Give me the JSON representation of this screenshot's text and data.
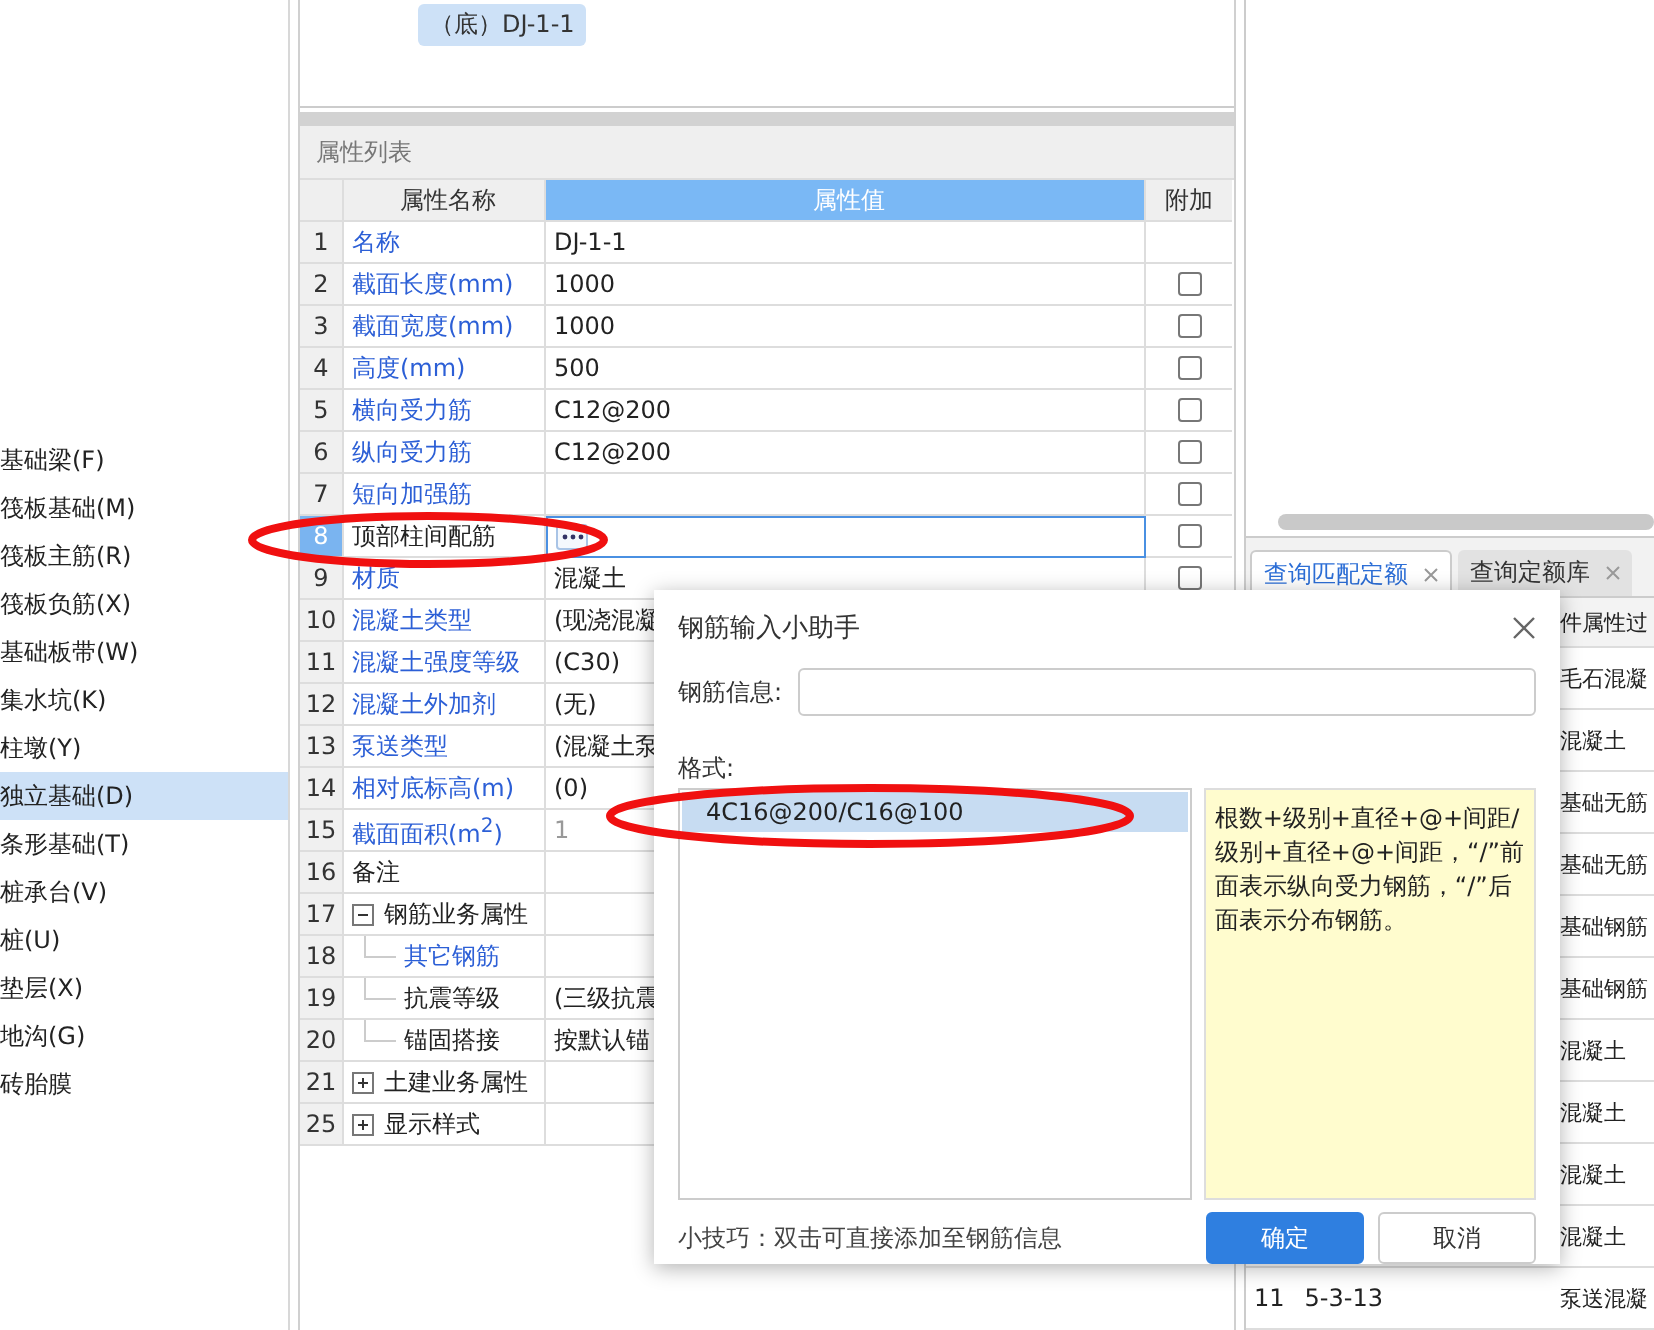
{
  "sidebar": {
    "items": [
      {
        "label": "基础梁(F)",
        "selected": false
      },
      {
        "label": "筏板基础(M)",
        "selected": false
      },
      {
        "label": "筏板主筋(R)",
        "selected": false
      },
      {
        "label": "筏板负筋(X)",
        "selected": false
      },
      {
        "label": "基础板带(W)",
        "selected": false
      },
      {
        "label": "集水坑(K)",
        "selected": false
      },
      {
        "label": "柱墩(Y)",
        "selected": false
      },
      {
        "label": "独立基础(D)",
        "selected": true
      },
      {
        "label": "条形基础(T)",
        "selected": false
      },
      {
        "label": "桩承台(V)",
        "selected": false
      },
      {
        "label": "桩(U)",
        "selected": false
      },
      {
        "label": "垫层(X)",
        "selected": false
      },
      {
        "label": "地沟(G)",
        "selected": false
      },
      {
        "label": "砖胎膜",
        "selected": false
      }
    ]
  },
  "preview": {
    "tag": "（底）DJ-1-1"
  },
  "properties": {
    "title": "属性列表",
    "columns": [
      {
        "label": "属性名称",
        "selected": false
      },
      {
        "label": "属性值",
        "selected": true
      },
      {
        "label": "附加",
        "selected": false
      }
    ],
    "rows": [
      {
        "number": "1",
        "name": "名称",
        "value": "DJ-1-1",
        "kind": "public",
        "selected": false
      },
      {
        "number": "2",
        "name": "截面长度(mm)",
        "value": "1000",
        "kind": "public",
        "selected": false,
        "checked": false
      },
      {
        "number": "3",
        "name": "截面宽度(mm)",
        "value": "1000",
        "kind": "public",
        "selected": false,
        "checked": false
      },
      {
        "number": "4",
        "name": "高度(mm)",
        "value": "500",
        "kind": "public",
        "selected": false,
        "checked": false
      },
      {
        "number": "5",
        "name": "横向受力筋",
        "value": "C12@200",
        "kind": "public",
        "selected": false,
        "checked": false
      },
      {
        "number": "6",
        "name": "纵向受力筋",
        "value": "C12@200",
        "kind": "public",
        "selected": false,
        "checked": false
      },
      {
        "number": "7",
        "name": "短向加强筋",
        "kind": "public",
        "selected": false,
        "checked": false
      },
      {
        "number": "8",
        "name": "顶部柱间配筋",
        "kind": "private",
        "selected": true,
        "checked": false
      },
      {
        "number": "9",
        "name": "材质",
        "value": "混凝土",
        "kind": "public",
        "selected": false,
        "checked": false
      },
      {
        "number": "10",
        "name": "混凝土类型",
        "value": "(现浇混凝",
        "kind": "public",
        "selected": false
      },
      {
        "number": "11",
        "name": "混凝土强度等级",
        "value": "(C30)",
        "kind": "public",
        "selected": false
      },
      {
        "number": "12",
        "name": "混凝土外加剂",
        "value": "(无)",
        "kind": "public",
        "selected": false
      },
      {
        "number": "13",
        "name": "泵送类型",
        "value": "(混凝土泵",
        "kind": "public",
        "selected": false
      },
      {
        "number": "14",
        "name": "相对底标高(m)",
        "value": "(0)",
        "kind": "public",
        "selected": false
      },
      {
        "number": "15",
        "name": "截面面积(m$^{2}$)",
        "value": "1",
        "kind": "public",
        "readonly": true,
        "selected": false
      },
      {
        "number": "16",
        "name": "备注",
        "kind": "private",
        "selected": false
      },
      {
        "number": "17",
        "name": "钢筋业务属性",
        "kind": "group",
        "expanded": true,
        "selected": false,
        "children": [
          {
            "number": "18",
            "name": "其它钢筋",
            "kind": "public",
            "selected": false
          },
          {
            "number": "19",
            "name": "抗震等级",
            "value": "(三级抗震",
            "kind": "private",
            "selected": false
          },
          {
            "number": "20",
            "name": "锚固搭接",
            "value": "按默认锚",
            "kind": "private",
            "selected": false
          }
        ]
      },
      {
        "number": "21",
        "name": "土建业务属性",
        "kind": "group",
        "expanded": false,
        "selected": false
      },
      {
        "number": "25",
        "name": "显示样式",
        "kind": "group",
        "expanded": false,
        "selected": false
      }
    ]
  },
  "quota_panel": {
    "tabs": [
      {
        "label": "查询匹配定额",
        "selected": true
      },
      {
        "label": "查询定额库",
        "selected": false
      }
    ],
    "header": "件属性过",
    "rows": [
      {
        "column_3": "毛石混凝"
      },
      {
        "column_3": "混凝土"
      },
      {
        "column_3": "基础无筋"
      },
      {
        "column_3": "基础无筋"
      },
      {
        "column_3": "基础钢筋"
      },
      {
        "column_3": "基础钢筋"
      },
      {
        "column_3": "混凝土"
      },
      {
        "column_3": "混凝土"
      },
      {
        "column_3": "混凝土"
      },
      {
        "column_3": "混凝土"
      },
      {
        "number": "11",
        "code": "5-3-13",
        "column_3": "泵送混凝"
      }
    ]
  },
  "dialog": {
    "title": "钢筋输入小助手",
    "info_label": "钢筋信息:",
    "format_label": "格式:",
    "formats": [
      {
        "text": "4C16@200/C16@100",
        "selected": true
      }
    ],
    "description": "根数+级别+直径+@+间距/级别+直径+@+间距，“/”前面表示纵向受力钢筋，“/”后面表示分布钢筋。",
    "tip": "小技巧：双击可直接添加至钢筋信息",
    "buttons": [
      {
        "label": "确定",
        "kind": "primary"
      },
      {
        "label": "取消",
        "kind": "secondary"
      }
    ]
  }
}
